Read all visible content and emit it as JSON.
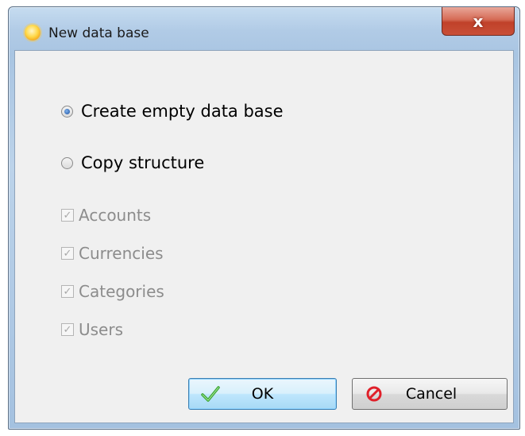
{
  "window": {
    "title": "New data base",
    "app_icon": "sun-icon",
    "close_glyph": "x"
  },
  "options": {
    "create_empty": {
      "label": "Create empty data base",
      "selected": true
    },
    "copy_structure": {
      "label": "Copy structure",
      "selected": false
    }
  },
  "structure_items": [
    {
      "label": "Accounts",
      "checked": true,
      "enabled": false
    },
    {
      "label": "Currencies",
      "checked": true,
      "enabled": false
    },
    {
      "label": "Categories",
      "checked": true,
      "enabled": false
    },
    {
      "label": "Users",
      "checked": true,
      "enabled": false
    }
  ],
  "buttons": {
    "ok": {
      "label": "OK",
      "icon": "checkmark-icon"
    },
    "cancel": {
      "label": "Cancel",
      "icon": "prohibited-icon"
    }
  },
  "colors": {
    "ok_check": "#3aa532",
    "cancel_icon": "#e0202a",
    "disabled_text": "#8c8c8c"
  }
}
